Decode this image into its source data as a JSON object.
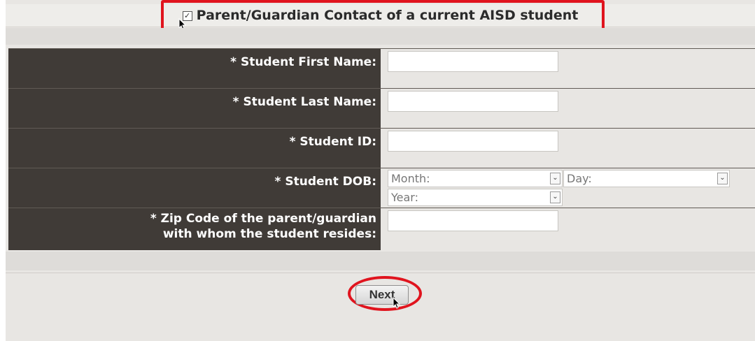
{
  "header": {
    "checkbox_checked": true,
    "title": "Parent/Guardian Contact of a current AISD student"
  },
  "form": {
    "first_name_label": "* Student First Name:",
    "last_name_label": "* Student Last Name:",
    "student_id_label": "* Student ID:",
    "dob_label": "* Student DOB:",
    "zip_label_line1": "* Zip Code of the parent/guardian",
    "zip_label_line2": "with whom the student resides:",
    "dob": {
      "month_placeholder": "Month:",
      "day_placeholder": "Day:",
      "year_placeholder": "Year:"
    }
  },
  "actions": {
    "next_label": "Next"
  },
  "colors": {
    "highlight": "#e0141e",
    "label_bg": "#403b37"
  }
}
